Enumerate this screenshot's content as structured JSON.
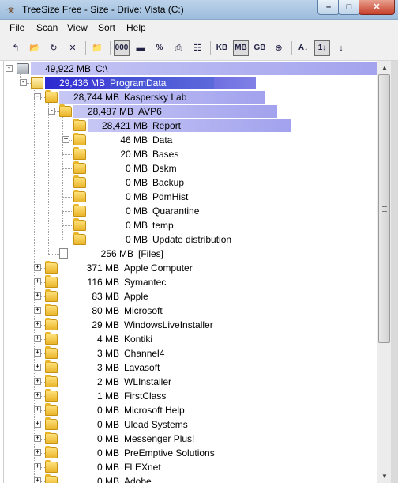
{
  "window": {
    "title": "TreeSize Free - Size -  Drive: Vista (C:)",
    "minimize": "–",
    "maximize": "□",
    "close": "✕"
  },
  "menu": [
    "File",
    "Scan",
    "View",
    "Sort",
    "Help"
  ],
  "toolbar": [
    {
      "name": "go-up-icon",
      "glyph": "↰",
      "pressed": false
    },
    {
      "name": "open-folder-icon",
      "glyph": "📂",
      "pressed": false
    },
    {
      "name": "refresh-icon",
      "glyph": "↻",
      "pressed": false
    },
    {
      "name": "stop-icon",
      "glyph": "✕",
      "pressed": false
    },
    {
      "sep": true
    },
    {
      "name": "browse-folder-icon",
      "glyph": "📁",
      "pressed": false
    },
    {
      "sep": true
    },
    {
      "name": "size-view-button",
      "glyph": "000",
      "pressed": true,
      "text": true
    },
    {
      "name": "drive-icon",
      "glyph": "▬",
      "pressed": false
    },
    {
      "name": "percent-view-button",
      "glyph": "%",
      "pressed": false,
      "text": true
    },
    {
      "name": "print-icon",
      "glyph": "⎙",
      "pressed": false
    },
    {
      "name": "details-view-icon",
      "glyph": "☷",
      "pressed": false
    },
    {
      "sep": true
    },
    {
      "name": "kb-unit-button",
      "glyph": "KB",
      "pressed": false,
      "text": true
    },
    {
      "name": "mb-unit-button",
      "glyph": "MB",
      "pressed": true,
      "text": true
    },
    {
      "name": "gb-unit-button",
      "glyph": "GB",
      "pressed": false,
      "text": true
    },
    {
      "name": "auto-unit-icon",
      "glyph": "⊕",
      "pressed": false
    },
    {
      "sep": true
    },
    {
      "name": "sort-name-icon",
      "glyph": "A↓",
      "pressed": false,
      "text": true
    },
    {
      "name": "sort-size-icon",
      "glyph": "1↓",
      "pressed": true,
      "text": true
    },
    {
      "name": "sort-direction-icon",
      "glyph": "↓",
      "pressed": false
    }
  ],
  "tree": [
    {
      "d": 0,
      "exp": "-",
      "icon": "drive",
      "size": "49,922 MB",
      "name": "C:\\",
      "bar": 1.0
    },
    {
      "d": 1,
      "exp": "-",
      "icon": "folder-open",
      "size": "29,436 MB",
      "name": "ProgramData",
      "bar": 0.59,
      "sel": true
    },
    {
      "d": 2,
      "exp": "-",
      "icon": "folder",
      "size": "28,744 MB",
      "name": "Kaspersky Lab",
      "bar": 0.576
    },
    {
      "d": 3,
      "exp": "-",
      "icon": "folder",
      "size": "28,487 MB",
      "name": "AVP6",
      "bar": 0.571
    },
    {
      "d": 4,
      "exp": "",
      "icon": "folder",
      "size": "28,421 MB",
      "name": "Report",
      "bar": 0.569
    },
    {
      "d": 4,
      "exp": "+",
      "icon": "folder",
      "size": "46 MB",
      "name": "Data",
      "bar": 0
    },
    {
      "d": 4,
      "exp": "",
      "icon": "folder",
      "size": "20 MB",
      "name": "Bases",
      "bar": 0
    },
    {
      "d": 4,
      "exp": "",
      "icon": "folder",
      "size": "0 MB",
      "name": "Dskm",
      "bar": 0
    },
    {
      "d": 4,
      "exp": "",
      "icon": "folder",
      "size": "0 MB",
      "name": "Backup",
      "bar": 0
    },
    {
      "d": 4,
      "exp": "",
      "icon": "folder",
      "size": "0 MB",
      "name": "PdmHist",
      "bar": 0
    },
    {
      "d": 4,
      "exp": "",
      "icon": "folder",
      "size": "0 MB",
      "name": "Quarantine",
      "bar": 0
    },
    {
      "d": 4,
      "exp": "",
      "icon": "folder",
      "size": "0 MB",
      "name": "temp",
      "bar": 0
    },
    {
      "d": 4,
      "exp": "",
      "icon": "folder",
      "size": "0 MB",
      "name": "Update distribution",
      "bar": 0
    },
    {
      "d": 3,
      "exp": "",
      "icon": "file",
      "size": "256 MB",
      "name": "[Files]",
      "bar": 0
    },
    {
      "d": 2,
      "exp": "+",
      "icon": "folder",
      "size": "371 MB",
      "name": "Apple Computer",
      "bar": 0
    },
    {
      "d": 2,
      "exp": "+",
      "icon": "folder",
      "size": "116 MB",
      "name": "Symantec",
      "bar": 0
    },
    {
      "d": 2,
      "exp": "+",
      "icon": "folder",
      "size": "83 MB",
      "name": "Apple",
      "bar": 0
    },
    {
      "d": 2,
      "exp": "+",
      "icon": "folder",
      "size": "80 MB",
      "name": "Microsoft",
      "bar": 0
    },
    {
      "d": 2,
      "exp": "+",
      "icon": "folder",
      "size": "29 MB",
      "name": "WindowsLiveInstaller",
      "bar": 0
    },
    {
      "d": 2,
      "exp": "+",
      "icon": "folder",
      "size": "4 MB",
      "name": "Kontiki",
      "bar": 0
    },
    {
      "d": 2,
      "exp": "+",
      "icon": "folder",
      "size": "3 MB",
      "name": "Channel4",
      "bar": 0
    },
    {
      "d": 2,
      "exp": "+",
      "icon": "folder",
      "size": "3 MB",
      "name": "Lavasoft",
      "bar": 0
    },
    {
      "d": 2,
      "exp": "+",
      "icon": "folder",
      "size": "2 MB",
      "name": "WLInstaller",
      "bar": 0
    },
    {
      "d": 2,
      "exp": "+",
      "icon": "folder",
      "size": "1 MB",
      "name": "FirstClass",
      "bar": 0
    },
    {
      "d": 2,
      "exp": "+",
      "icon": "folder",
      "size": "0 MB",
      "name": "Microsoft Help",
      "bar": 0
    },
    {
      "d": 2,
      "exp": "+",
      "icon": "folder",
      "size": "0 MB",
      "name": "Ulead Systems",
      "bar": 0
    },
    {
      "d": 2,
      "exp": "+",
      "icon": "folder",
      "size": "0 MB",
      "name": "Messenger Plus!",
      "bar": 0
    },
    {
      "d": 2,
      "exp": "+",
      "icon": "folder",
      "size": "0 MB",
      "name": "PreEmptive Solutions",
      "bar": 0
    },
    {
      "d": 2,
      "exp": "+",
      "icon": "folder",
      "size": "0 MB",
      "name": "FLEXnet",
      "bar": 0
    },
    {
      "d": 2,
      "exp": "+",
      "icon": "folder",
      "size": "0 MB",
      "name": "Adobe",
      "bar": 0
    }
  ],
  "scrollbar": {
    "up": "▲",
    "down": "▼"
  }
}
